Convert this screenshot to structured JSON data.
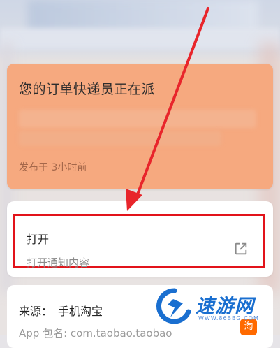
{
  "notification": {
    "title": "您的订单快递员正在派",
    "time": "发布于 3小时前",
    "bg_color": "#f6a97f"
  },
  "action": {
    "title": "打开",
    "subtitle": "打开通知内容",
    "icon": "external-link-icon",
    "highlight_color": "#e2131a"
  },
  "source": {
    "label": "来源：",
    "app_name": "手机淘宝",
    "package": "App 包名: com.taobao.taobao",
    "app_icon_text": "淘"
  },
  "watermark": {
    "text": "速游网",
    "url": "WWW.86BBG.COM",
    "color": "#1a6fd0"
  },
  "annotation": {
    "arrow_color": "#e8252b"
  }
}
